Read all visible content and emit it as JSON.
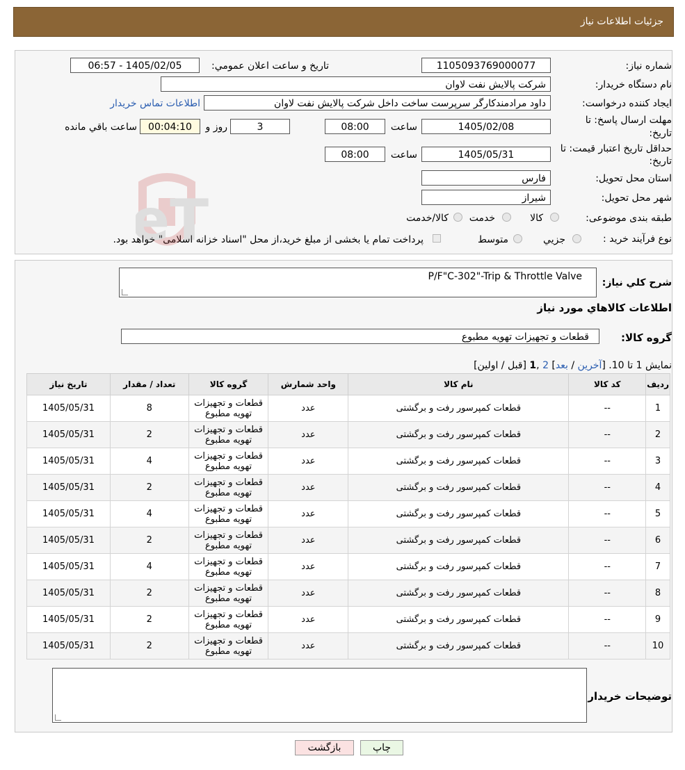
{
  "header": {
    "title": "جزئیات اطلاعات نیاز"
  },
  "form": {
    "need_number_label": "شماره نیاز:",
    "need_number": "1105093769000077",
    "announce_label": "تاریخ و ساعت اعلان عمومي:",
    "announce_value": "1405/02/05 - 06:57",
    "buyer_org_label": "نام دستگاه خريدار:",
    "buyer_org": "شرکت پالايش نفت لاوان",
    "creator_label": "ايجاد کننده درخواست:",
    "creator": "داود مرادمندکارگر سرپرست ساخت داخل شرکت پالايش نفت لاوان",
    "contact_link": "اطلاعات تماس خريدار",
    "deadline_label_1": "مهلت ارسال پاسخ: تا",
    "deadline_label_2": "تاريخ:",
    "deadline_date": "1405/02/08",
    "time_label": "ساعت",
    "deadline_time": "08:00",
    "days": "3",
    "days_label": "روز و",
    "remaining": "00:04:10",
    "remaining_label": "ساعت باقي مانده",
    "validity_label_1": "حداقل تاريخ اعتبار قيمت: تا",
    "validity_label_2": "تاريخ:",
    "validity_date": "1405/05/31",
    "validity_time_label": "ساعت",
    "validity_time": "08:00",
    "province_label": "استان محل تحويل:",
    "province": "فارس",
    "city_label": "شهر محل تحويل:",
    "city": "شيراز",
    "category_label": "طبقه بندی موضوعی:",
    "category_options": [
      "کالا",
      "خدمت",
      "کالا/خدمت"
    ],
    "process_label": "نوع فرآيند خريد :",
    "process_options": [
      "جزيي",
      "متوسط"
    ],
    "process_note": "پرداخت تمام يا بخشی از مبلغ خريد،از محل \"اسناد خزانه اسلامی\" خواهد بود."
  },
  "details": {
    "desc_label": "شرح کلي نياز:",
    "desc_value": "P/F\"C-302\"-Trip & Throttle Valve",
    "goods_info_title": "اطلاعات کالاهاي مورد نياز",
    "group_label": "گروه کالا:",
    "group_value": "قطعات و تجهيزات تهويه مطبوع",
    "pager": {
      "prefix": "نمايش 1 تا 10. [",
      "last": "آخرين",
      "sep1": " / ",
      "next": "بعد",
      "sep2": "] ",
      "page2": "2",
      "comma": " ,",
      "page1": "1",
      "suffix": " [قبل / اولين]"
    },
    "columns": [
      "رديف",
      "کد کالا",
      "نام کالا",
      "واحد شمارش",
      "گروه کالا",
      "تعداد / مقدار",
      "تاريخ نياز"
    ],
    "rows": [
      {
        "idx": "1",
        "code": "--",
        "name": "قطعات کمپرسور رفت و برگشتی",
        "unit": "عدد",
        "group": "قطعات و تجهيزات تهويه مطبوع",
        "qty": "8",
        "date": "1405/05/31"
      },
      {
        "idx": "2",
        "code": "--",
        "name": "قطعات کمپرسور رفت و برگشتی",
        "unit": "عدد",
        "group": "قطعات و تجهيزات تهويه مطبوع",
        "qty": "2",
        "date": "1405/05/31"
      },
      {
        "idx": "3",
        "code": "--",
        "name": "قطعات کمپرسور رفت و برگشتی",
        "unit": "عدد",
        "group": "قطعات و تجهيزات تهويه مطبوع",
        "qty": "4",
        "date": "1405/05/31"
      },
      {
        "idx": "4",
        "code": "--",
        "name": "قطعات کمپرسور رفت و برگشتی",
        "unit": "عدد",
        "group": "قطعات و تجهيزات تهويه مطبوع",
        "qty": "2",
        "date": "1405/05/31"
      },
      {
        "idx": "5",
        "code": "--",
        "name": "قطعات کمپرسور رفت و برگشتی",
        "unit": "عدد",
        "group": "قطعات و تجهيزات تهويه مطبوع",
        "qty": "4",
        "date": "1405/05/31"
      },
      {
        "idx": "6",
        "code": "--",
        "name": "قطعات کمپرسور رفت و برگشتی",
        "unit": "عدد",
        "group": "قطعات و تجهيزات تهويه مطبوع",
        "qty": "2",
        "date": "1405/05/31"
      },
      {
        "idx": "7",
        "code": "--",
        "name": "قطعات کمپرسور رفت و برگشتی",
        "unit": "عدد",
        "group": "قطعات و تجهيزات تهويه مطبوع",
        "qty": "4",
        "date": "1405/05/31"
      },
      {
        "idx": "8",
        "code": "--",
        "name": "قطعات کمپرسور رفت و برگشتی",
        "unit": "عدد",
        "group": "قطعات و تجهيزات تهويه مطبوع",
        "qty": "2",
        "date": "1405/05/31"
      },
      {
        "idx": "9",
        "code": "--",
        "name": "قطعات کمپرسور رفت و برگشتی",
        "unit": "عدد",
        "group": "قطعات و تجهيزات تهويه مطبوع",
        "qty": "2",
        "date": "1405/05/31"
      },
      {
        "idx": "10",
        "code": "--",
        "name": "قطعات کمپرسور رفت و برگشتی",
        "unit": "عدد",
        "group": "قطعات و تجهيزات تهويه مطبوع",
        "qty": "2",
        "date": "1405/05/31"
      }
    ],
    "buyer_notes_label": "توضيحات خريدار:"
  },
  "buttons": {
    "back": "بازگشت",
    "print": "چاپ"
  },
  "watermark": {
    "text": "AriaTender.neT"
  },
  "colors": {
    "header_bg": "#8b6536",
    "back_btn": "#fbe2e2",
    "print_btn": "#eaf7e4",
    "link": "#2a5db0"
  }
}
